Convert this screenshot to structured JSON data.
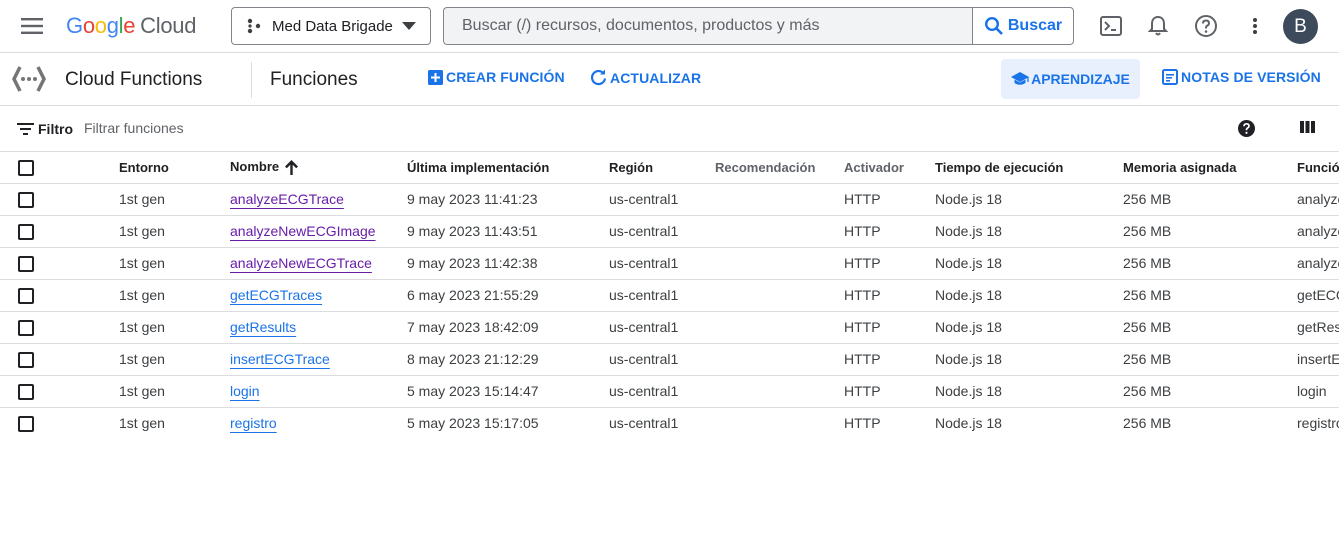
{
  "header": {
    "logo_google": [
      "G",
      "o",
      "o",
      "g",
      "l",
      "e"
    ],
    "logo_cloud": "Cloud",
    "project": "Med Data Brigade",
    "search_placeholder": "Buscar (/) recursos, documentos, productos y más",
    "search_button": "Buscar",
    "avatar_letter": "B"
  },
  "subbar": {
    "product_name": "Cloud Functions",
    "page_title": "Funciones",
    "create_label": "CREAR FUNCIÓN",
    "refresh_label": "ACTUALIZAR",
    "learn_label": "APRENDIZAJE",
    "release_notes_label": "NOTAS DE VERSIÓN"
  },
  "filter": {
    "label": "Filtro",
    "placeholder": "Filtrar funciones"
  },
  "table": {
    "headers": {
      "environment": "Entorno",
      "name": "Nombre",
      "last_deploy": "Última implementación",
      "region": "Región",
      "recommendation": "Recomendación",
      "trigger": "Activador",
      "runtime": "Tiempo de ejecución",
      "memory": "Memoria asignada",
      "function": "Función"
    },
    "rows": [
      {
        "env": "1st gen",
        "name": "analyzeECGTrace",
        "visited": true,
        "date": "9 may 2023 11:41:23",
        "region": "us-central1",
        "rec": "",
        "trigger": "HTTP",
        "runtime": "Node.js 18",
        "memory": "256 MB",
        "entry": "analyzeECGTrace"
      },
      {
        "env": "1st gen",
        "name": "analyzeNewECGImage",
        "visited": true,
        "date": "9 may 2023 11:43:51",
        "region": "us-central1",
        "rec": "",
        "trigger": "HTTP",
        "runtime": "Node.js 18",
        "memory": "256 MB",
        "entry": "analyzeNewECGImage"
      },
      {
        "env": "1st gen",
        "name": "analyzeNewECGTrace",
        "visited": true,
        "date": "9 may 2023 11:42:38",
        "region": "us-central1",
        "rec": "",
        "trigger": "HTTP",
        "runtime": "Node.js 18",
        "memory": "256 MB",
        "entry": "analyzeNewECGTrace"
      },
      {
        "env": "1st gen",
        "name": "getECGTraces",
        "visited": false,
        "date": "6 may 2023 21:55:29",
        "region": "us-central1",
        "rec": "",
        "trigger": "HTTP",
        "runtime": "Node.js 18",
        "memory": "256 MB",
        "entry": "getECGTraces"
      },
      {
        "env": "1st gen",
        "name": "getResults",
        "visited": false,
        "date": "7 may 2023 18:42:09",
        "region": "us-central1",
        "rec": "",
        "trigger": "HTTP",
        "runtime": "Node.js 18",
        "memory": "256 MB",
        "entry": "getResults"
      },
      {
        "env": "1st gen",
        "name": "insertECGTrace",
        "visited": false,
        "date": "8 may 2023 21:12:29",
        "region": "us-central1",
        "rec": "",
        "trigger": "HTTP",
        "runtime": "Node.js 18",
        "memory": "256 MB",
        "entry": "insertECGTrace"
      },
      {
        "env": "1st gen",
        "name": "login",
        "visited": false,
        "date": "5 may 2023 15:14:47",
        "region": "us-central1",
        "rec": "",
        "trigger": "HTTP",
        "runtime": "Node.js 18",
        "memory": "256 MB",
        "entry": "login"
      },
      {
        "env": "1st gen",
        "name": "registro",
        "visited": false,
        "date": "5 may 2023 15:17:05",
        "region": "us-central1",
        "rec": "",
        "trigger": "HTTP",
        "runtime": "Node.js 18",
        "memory": "256 MB",
        "entry": "registro"
      }
    ]
  },
  "colors": {
    "accent": "#1a73e8",
    "visited_link": "#681da8",
    "status_ok": "#1e8e3e",
    "divider": "#dadce0"
  }
}
